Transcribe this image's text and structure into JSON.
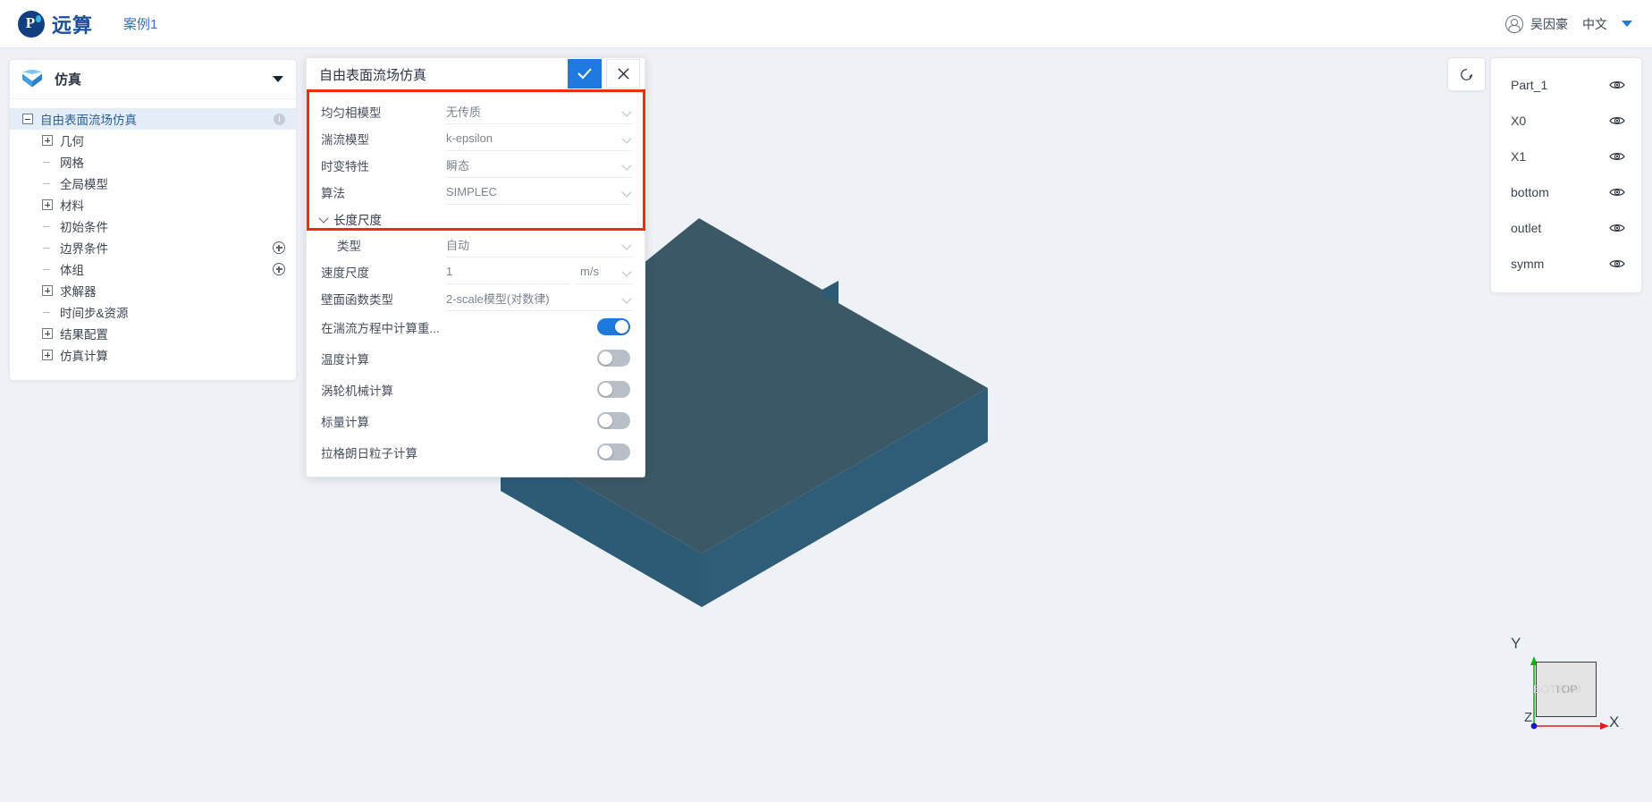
{
  "topbar": {
    "brand": "远算",
    "case_name": "案例1",
    "user_name": "吴因豪",
    "language": "中文",
    "accent_color": "#1a4f9c"
  },
  "left_panel": {
    "header_title": "仿真",
    "tree": [
      {
        "label": "自由表面流场仿真",
        "icon": "minus-expander",
        "depth": 0,
        "selected": true,
        "badge": "i"
      },
      {
        "label": "几何",
        "icon": "plus-expander",
        "depth": 1
      },
      {
        "label": "网格",
        "icon": "dash",
        "depth": 1
      },
      {
        "label": "全局模型",
        "icon": "dash",
        "depth": 1
      },
      {
        "label": "材料",
        "icon": "plus-expander",
        "depth": 1
      },
      {
        "label": "初始条件",
        "icon": "dash",
        "depth": 1
      },
      {
        "label": "边界条件",
        "icon": "dash",
        "depth": 1,
        "add": true
      },
      {
        "label": "体组",
        "icon": "dash",
        "depth": 1,
        "add": true
      },
      {
        "label": "求解器",
        "icon": "plus-expander",
        "depth": 1
      },
      {
        "label": "时间步&资源",
        "icon": "dash",
        "depth": 1
      },
      {
        "label": "结果配置",
        "icon": "plus-expander",
        "depth": 1
      },
      {
        "label": "仿真计算",
        "icon": "plus-expander",
        "depth": 1
      }
    ]
  },
  "dialog": {
    "title": "自由表面流场仿真",
    "confirm_label": "✓",
    "close_label": "✕",
    "fields": [
      {
        "label": "均匀相模型",
        "value": "无传质",
        "type": "select"
      },
      {
        "label": "湍流模型",
        "value": "k-epsilon",
        "type": "select"
      },
      {
        "label": "时变特性",
        "value": "瞬态",
        "type": "select"
      },
      {
        "label": "算法",
        "value": "SIMPLEC",
        "type": "select"
      }
    ],
    "group": {
      "title": "长度尺度",
      "expanded": true,
      "fields": [
        {
          "label": "类型",
          "value": "自动",
          "type": "select",
          "indent": true
        }
      ]
    },
    "fields2": [
      {
        "label": "速度尺度",
        "value": "1",
        "unit": "m/s",
        "type": "number-unit"
      },
      {
        "label": "壁面函数类型",
        "value": "2-scale模型(对数律)",
        "type": "select"
      }
    ],
    "toggles": [
      {
        "label": "在湍流方程中计算重...",
        "on": true
      },
      {
        "label": "温度计算",
        "on": false
      },
      {
        "label": "涡轮机械计算",
        "on": false
      },
      {
        "label": "标量计算",
        "on": false
      },
      {
        "label": "拉格朗日粒子计算",
        "on": false
      }
    ],
    "highlight_color": "#ee2d0f"
  },
  "viewport": {
    "reset_view_icon": "reset-circular-arrow-icon",
    "model_top_color": "#3b5866",
    "model_side_color": "#2d5b76",
    "background_color": "#eef1f5"
  },
  "parts_panel": {
    "parts": [
      {
        "name": "Part_1",
        "visible": true
      },
      {
        "name": "X0",
        "visible": true
      },
      {
        "name": "X1",
        "visible": true
      },
      {
        "name": "bottom",
        "visible": true
      },
      {
        "name": "outlet",
        "visible": true
      },
      {
        "name": "symm",
        "visible": true
      }
    ]
  },
  "triad": {
    "x_label": "X",
    "y_label": "Y",
    "z_label": "Z",
    "cube_face": "TOP",
    "cube_face_ghost": "BOTTOM",
    "x_color": "#e02020",
    "y_color": "#13b313",
    "z_color": "#1515cc"
  }
}
